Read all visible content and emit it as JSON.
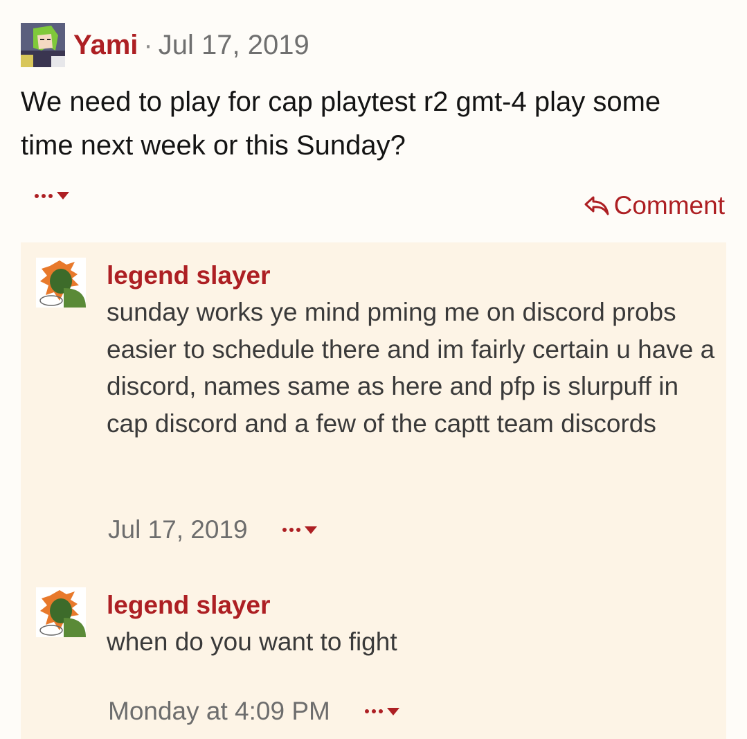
{
  "post": {
    "author": "Yami",
    "separator": "·",
    "date": "Jul 17, 2019",
    "body": "We need to play for cap playtest r2 gmt-4 play some time next week or this Sunday?",
    "comment_label": "Comment"
  },
  "comments": [
    {
      "author": "legend slayer",
      "text": "sunday works ye mind pming me on discord probs easier to schedule there and im fairly certain u have a discord, names same as here and pfp is slurpuff in cap discord and a few of the captt team discords",
      "date": "Jul 17, 2019"
    },
    {
      "author": "legend slayer",
      "text": "when do you want to fight",
      "date": "Monday at 4:09 PM"
    }
  ],
  "icons": {
    "more": "more-options-icon",
    "reply": "reply-arrow-icon"
  },
  "colors": {
    "accent": "#ad1f23",
    "background": "#fefcf8",
    "comment_background": "#fdf4e6"
  }
}
